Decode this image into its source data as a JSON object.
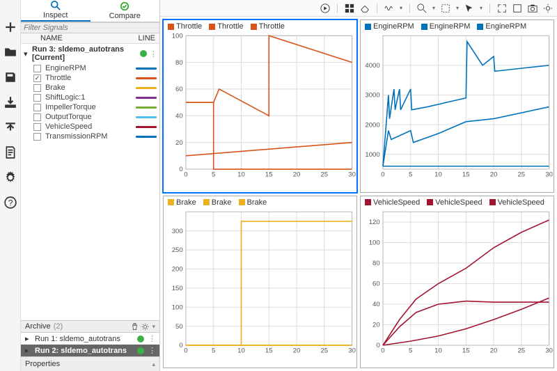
{
  "tabs": {
    "inspect": "Inspect",
    "compare": "Compare"
  },
  "filter_placeholder": "Filter Signals",
  "col_name": "NAME",
  "col_line": "LINE",
  "run_label": "Run 3: sldemo_autotrans [Current]",
  "run_dot_color": "#3bb143",
  "signals": [
    {
      "name": "EngineRPM",
      "color": "#0072bd",
      "checked": false
    },
    {
      "name": "Throttle",
      "color": "#d95319",
      "checked": true
    },
    {
      "name": "Brake",
      "color": "#edb120",
      "checked": false
    },
    {
      "name": "ShiftLogic:1",
      "color": "#7e2f8e",
      "checked": false
    },
    {
      "name": "ImpellerTorque",
      "color": "#77ac30",
      "checked": false
    },
    {
      "name": "OutputTorque",
      "color": "#4dbeee",
      "checked": false
    },
    {
      "name": "VehicleSpeed",
      "color": "#a2142f",
      "checked": false
    },
    {
      "name": "TransmissionRPM",
      "color": "#0072bd",
      "checked": false
    }
  ],
  "archive": {
    "title": "Archive",
    "count": "(2)",
    "items": [
      {
        "name": "Run 1: sldemo_autotrans",
        "sel": false
      },
      {
        "name": "Run 2: sldemo_autotrans",
        "sel": true
      }
    ]
  },
  "properties": "Properties",
  "chart_data": [
    {
      "type": "line",
      "title": "",
      "series_name": "Throttle",
      "color": "#d95319",
      "selected": true,
      "xlim": [
        0,
        30
      ],
      "ylim": [
        0,
        100
      ],
      "xticks": [
        0,
        5,
        10,
        15,
        20,
        25,
        30
      ],
      "yticks": [
        0,
        20,
        40,
        60,
        80,
        100
      ],
      "series": [
        {
          "x": [
            0,
            5,
            6,
            15,
            15,
            30
          ],
          "y": [
            50,
            50,
            60,
            40,
            100,
            80
          ]
        },
        {
          "x": [
            0,
            30
          ],
          "y": [
            10,
            20
          ]
        },
        {
          "x": [
            0,
            5,
            5,
            30
          ],
          "y": [
            50,
            50,
            0,
            0
          ]
        }
      ]
    },
    {
      "type": "line",
      "title": "",
      "series_name": "EngineRPM",
      "color": "#0072bd",
      "selected": false,
      "xlim": [
        0,
        30
      ],
      "ylim": [
        500,
        5000
      ],
      "xticks": [
        0,
        5,
        10,
        15,
        20,
        25,
        30
      ],
      "yticks": [
        1000,
        2000,
        3000,
        4000
      ],
      "series": [
        {
          "x": [
            0,
            1,
            1.2,
            2,
            2.2,
            3,
            3.2,
            5,
            5.2,
            8,
            15,
            15.2,
            18,
            20,
            20.2,
            25,
            30
          ],
          "y": [
            600,
            3000,
            2200,
            3200,
            2500,
            3200,
            2500,
            3200,
            2500,
            2600,
            2900,
            4800,
            4000,
            4300,
            3800,
            3900,
            4000
          ]
        },
        {
          "x": [
            0,
            1,
            1.5,
            5,
            5.5,
            10,
            15,
            20,
            30
          ],
          "y": [
            600,
            1800,
            1500,
            1800,
            1400,
            1700,
            2100,
            2200,
            2600
          ]
        },
        {
          "x": [
            0,
            30
          ],
          "y": [
            600,
            600
          ]
        }
      ]
    },
    {
      "type": "line",
      "title": "",
      "series_name": "Brake",
      "color": "#edb120",
      "selected": false,
      "xlim": [
        0,
        30
      ],
      "ylim": [
        0,
        350
      ],
      "xticks": [
        0,
        5,
        10,
        15,
        20,
        25,
        30
      ],
      "yticks": [
        0,
        50,
        100,
        150,
        200,
        250,
        300
      ],
      "series": [
        {
          "x": [
            0,
            10,
            10,
            30
          ],
          "y": [
            0,
            0,
            325,
            325
          ]
        },
        {
          "x": [
            0,
            30
          ],
          "y": [
            0,
            0
          ]
        },
        {
          "x": [
            0,
            30
          ],
          "y": [
            0,
            0
          ]
        }
      ]
    },
    {
      "type": "line",
      "title": "",
      "series_name": "VehicleSpeed",
      "color": "#a2142f",
      "selected": false,
      "xlim": [
        0,
        30
      ],
      "ylim": [
        0,
        130
      ],
      "xticks": [
        0,
        5,
        10,
        15,
        20,
        25,
        30
      ],
      "yticks": [
        0,
        20,
        40,
        60,
        80,
        100,
        120
      ],
      "series": [
        {
          "x": [
            0,
            3,
            6,
            10,
            15,
            20,
            25,
            30
          ],
          "y": [
            0,
            25,
            45,
            60,
            75,
            95,
            110,
            122
          ]
        },
        {
          "x": [
            0,
            3,
            6,
            10,
            15,
            20,
            25,
            30
          ],
          "y": [
            0,
            18,
            32,
            40,
            43,
            42,
            42,
            42
          ]
        },
        {
          "x": [
            0,
            5,
            10,
            15,
            20,
            25,
            30
          ],
          "y": [
            0,
            4,
            9,
            16,
            25,
            35,
            46
          ]
        }
      ]
    }
  ]
}
